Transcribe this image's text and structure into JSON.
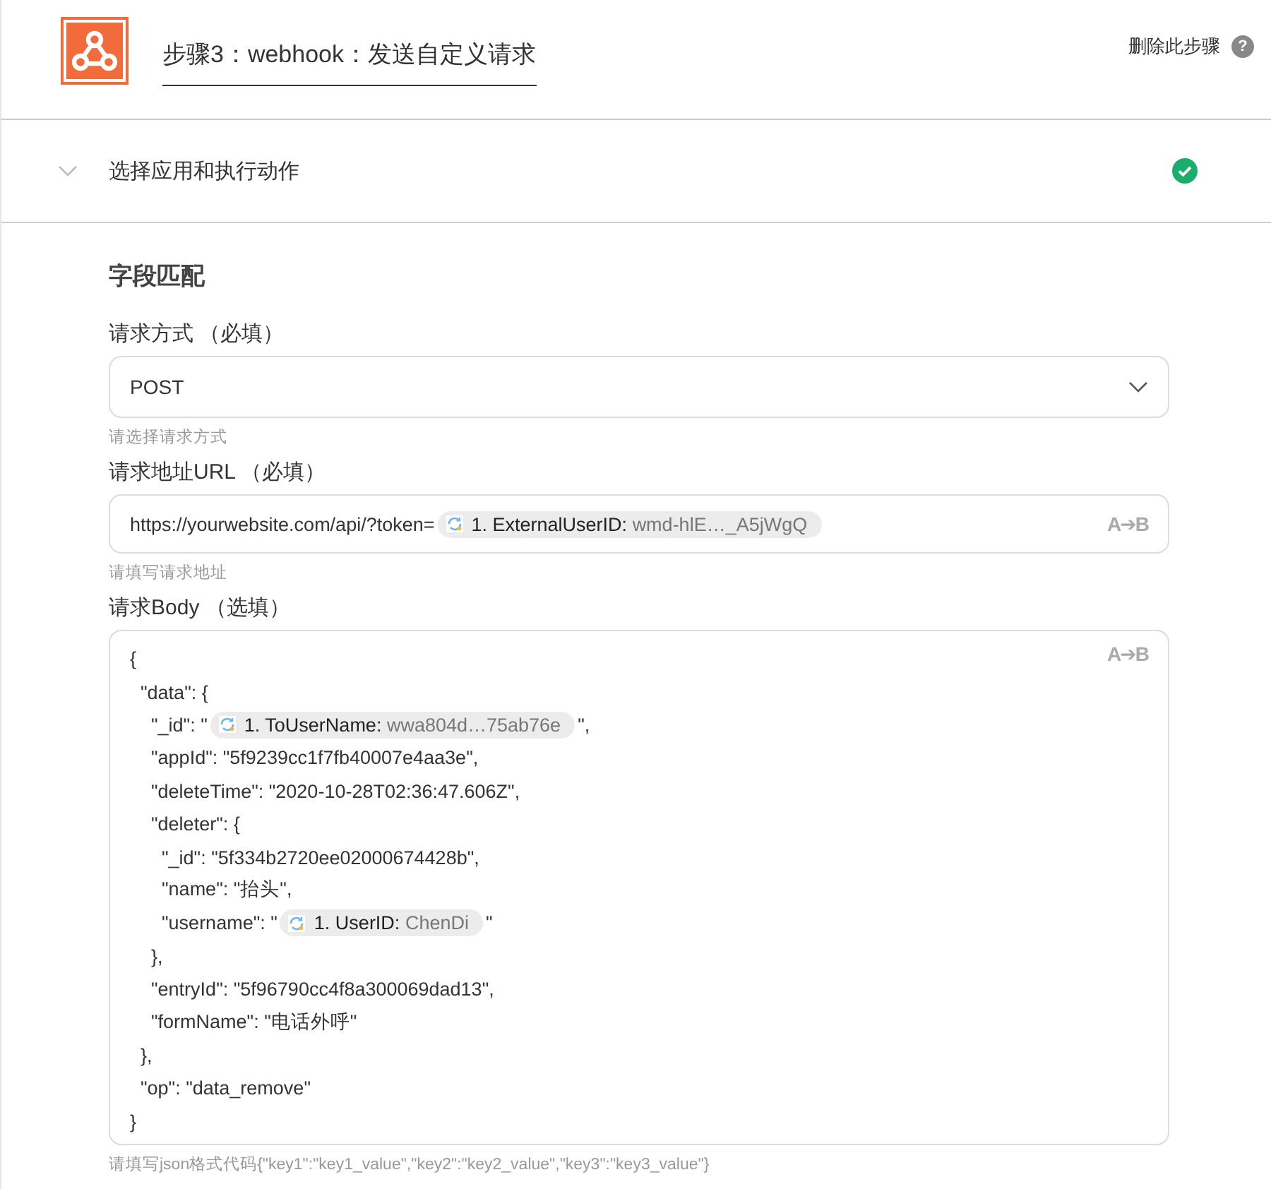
{
  "header": {
    "title": "步骤3：webhook：发送自定义请求",
    "delete_link": "删除此步骤",
    "help": "?"
  },
  "section": {
    "title": "选择应用和执行动作",
    "expanded": false,
    "complete": true
  },
  "field_mapping": {
    "title": "字段匹配",
    "method": {
      "label": "请求方式 （必填）",
      "value": "POST",
      "hint": "请选择请求方式"
    },
    "url": {
      "label": "请求地址URL （必填）",
      "mapper": "A➔B",
      "hint": "请填写请求地址",
      "parts": [
        {
          "kind": "text",
          "text": "https://yourwebsite.com/api/?token="
        },
        {
          "kind": "token",
          "step": "1. ExternalUserID:",
          "value": "wmd-hlE…_A5jWgQ"
        }
      ]
    },
    "body": {
      "label": "请求Body （选填）",
      "mapper": "A➔B",
      "hint": "请填写json格式代码{\"key1\":\"key1_value\",\"key2\":\"key2_value\",\"key3\":\"key3_value\"}",
      "lines": [
        [
          {
            "kind": "text",
            "text": "{"
          }
        ],
        [
          {
            "kind": "text",
            "text": "  \"data\": {"
          }
        ],
        [
          {
            "kind": "text",
            "text": "    \"_id\": \""
          },
          {
            "kind": "token",
            "step": "1. ToUserName:",
            "value": "wwa804d…75ab76e"
          },
          {
            "kind": "text",
            "text": "\","
          }
        ],
        [
          {
            "kind": "text",
            "text": "    \"appId\": \"5f9239cc1f7fb40007e4aa3e\","
          }
        ],
        [
          {
            "kind": "text",
            "text": "    \"deleteTime\": \"2020-10-28T02:36:47.606Z\","
          }
        ],
        [
          {
            "kind": "text",
            "text": "    \"deleter\": {"
          }
        ],
        [
          {
            "kind": "text",
            "text": "      \"_id\": \"5f334b2720ee02000674428b\","
          }
        ],
        [
          {
            "kind": "text",
            "text": "      \"name\": \"抬头\","
          }
        ],
        [
          {
            "kind": "text",
            "text": "      \"username\": \""
          },
          {
            "kind": "token",
            "step": "1. UserID:",
            "value": "ChenDi"
          },
          {
            "kind": "text",
            "text": "\""
          }
        ],
        [
          {
            "kind": "text",
            "text": "    },"
          }
        ],
        [
          {
            "kind": "text",
            "text": "    \"entryId\": \"5f96790cc4f8a300069dad13\","
          }
        ],
        [
          {
            "kind": "text",
            "text": "    \"formName\": \"电话外呼\""
          }
        ],
        [
          {
            "kind": "text",
            "text": "  },"
          }
        ],
        [
          {
            "kind": "text",
            "text": "  \"op\": \"data_remove\""
          }
        ],
        [
          {
            "kind": "text",
            "text": "}"
          }
        ]
      ]
    }
  }
}
